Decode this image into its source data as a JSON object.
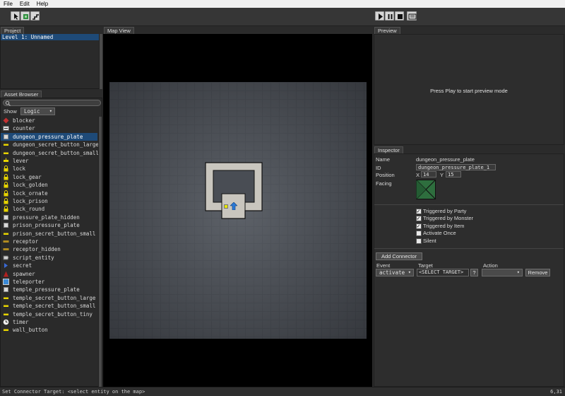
{
  "menu": {
    "file": "File",
    "edit": "Edit",
    "help": "Help"
  },
  "toolbar": {
    "left_icons": [
      "select-icon",
      "paint-icon",
      "stairs-icon"
    ],
    "right_icons": [
      "play-icon",
      "pause-icon",
      "stop-icon",
      "map-export-icon"
    ]
  },
  "project": {
    "tab": "Project",
    "selected_item": "Level 1: Unnamed"
  },
  "asset_browser": {
    "tab": "Asset Browser",
    "show_label": "Show",
    "show_value": "Logic",
    "items": [
      {
        "label": "blocker",
        "icon": "blocker-icon"
      },
      {
        "label": "counter",
        "icon": "counter-icon"
      },
      {
        "label": "dungeon_pressure_plate",
        "icon": "plate-icon",
        "selected": true
      },
      {
        "label": "dungeon_secret_button_large",
        "icon": "button-icon"
      },
      {
        "label": "dungeon_secret_button_small",
        "icon": "button-icon"
      },
      {
        "label": "lever",
        "icon": "lever-icon"
      },
      {
        "label": "lock",
        "icon": "lock-icon"
      },
      {
        "label": "lock_gear",
        "icon": "lock-icon"
      },
      {
        "label": "lock_golden",
        "icon": "lock-icon"
      },
      {
        "label": "lock_ornate",
        "icon": "lock-icon"
      },
      {
        "label": "lock_prison",
        "icon": "lock-icon"
      },
      {
        "label": "lock_round",
        "icon": "lock-icon"
      },
      {
        "label": "pressure_plate_hidden",
        "icon": "plate-icon"
      },
      {
        "label": "prison_pressure_plate",
        "icon": "plate-icon"
      },
      {
        "label": "prison_secret_button_small",
        "icon": "button-icon"
      },
      {
        "label": "receptor",
        "icon": "receptor-icon"
      },
      {
        "label": "receptor_hidden",
        "icon": "receptor-icon"
      },
      {
        "label": "script_entity",
        "icon": "script-icon"
      },
      {
        "label": "secret",
        "icon": "secret-icon"
      },
      {
        "label": "spawner",
        "icon": "spawner-icon"
      },
      {
        "label": "teleporter",
        "icon": "teleporter-icon"
      },
      {
        "label": "temple_pressure_plate",
        "icon": "plate-icon"
      },
      {
        "label": "temple_secret_button_large",
        "icon": "button-icon"
      },
      {
        "label": "temple_secret_button_small",
        "icon": "button-icon"
      },
      {
        "label": "temple_secret_button_tiny",
        "icon": "button-icon"
      },
      {
        "label": "timer",
        "icon": "timer-icon"
      },
      {
        "label": "wall_button",
        "icon": "button-icon"
      }
    ]
  },
  "map_view": {
    "tab": "Map View"
  },
  "preview": {
    "tab": "Preview",
    "message": "Press Play to start preview mode"
  },
  "inspector": {
    "tab": "Inspector",
    "name_label": "Name",
    "name_value": "dungeon_pressure_plate",
    "id_label": "ID",
    "id_value": "dungeon_pressure_plate_1",
    "position_label": "Position",
    "x_label": "X",
    "x_value": "14",
    "y_label": "Y",
    "y_value": "15",
    "facing_label": "Facing",
    "checkboxes": [
      {
        "label": "Triggered by Party",
        "checked": true
      },
      {
        "label": "Triggered by Monster",
        "checked": true
      },
      {
        "label": "Triggered by Item",
        "checked": true
      },
      {
        "label": "Activate Once",
        "checked": false
      },
      {
        "label": "Silent",
        "checked": false
      }
    ],
    "add_connector": "Add Connector",
    "event_header": "Event",
    "target_header": "Target",
    "action_header": "Action",
    "event_value": "activate",
    "target_value": "<SELECT TARGET>",
    "target_btn": "?",
    "action_value": "",
    "remove": "Remove"
  },
  "status": {
    "message": "Set Connector Target: <select entity on the map>",
    "coords": "6,31"
  }
}
